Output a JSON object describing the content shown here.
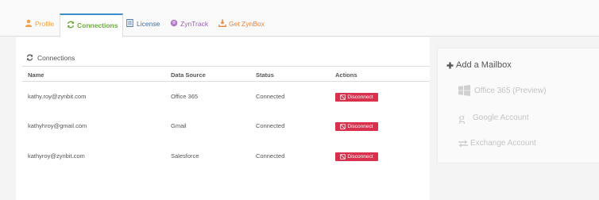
{
  "tabs": [
    {
      "label": "Profile",
      "color": "#f0a24a"
    },
    {
      "label": "Connections",
      "color": "#6aaa3a"
    },
    {
      "label": "License",
      "color": "#3a6fb0"
    },
    {
      "label": "ZynTrack",
      "color": "#9b5fb8"
    },
    {
      "label": "Get ZynBox",
      "color": "#e8843a"
    }
  ],
  "connections": {
    "title": "Connections",
    "columns": [
      "Name",
      "Data Source",
      "Status",
      "Actions"
    ],
    "rows": [
      {
        "name": "kathy.roy@zynbit.com",
        "source": "Office 365",
        "status": "Connected",
        "action": "Disconnect"
      },
      {
        "name": "kathyhroy@gmail.com",
        "source": "Gmail",
        "status": "Connected",
        "action": "Disconnect"
      },
      {
        "name": "kathyroy@zynbit.com",
        "source": "Salesforce",
        "status": "Connected",
        "action": "Disconnect"
      }
    ]
  },
  "mailbox": {
    "title": "Add a Mailbox",
    "options": [
      "Office 365 (Preview)",
      "Google Account",
      "Exchange Account"
    ]
  },
  "colors": {
    "accent": "#3a8fc8",
    "danger": "#d9304e",
    "muted": "#c4c4c4"
  }
}
